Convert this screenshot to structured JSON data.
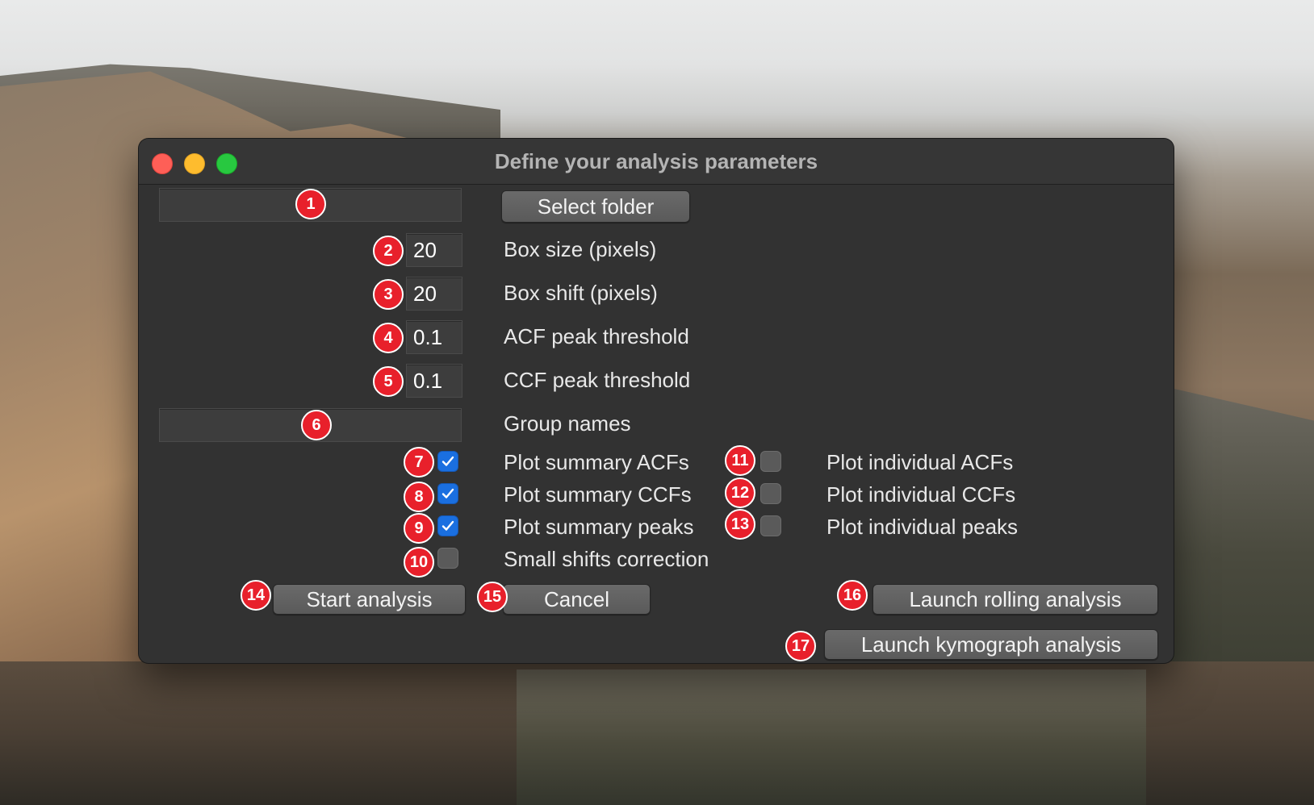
{
  "window": {
    "title": "Define your analysis parameters"
  },
  "form": {
    "folder_path": "",
    "select_folder_label": "Select folder",
    "box_size": {
      "value": "20",
      "label": "Box size (pixels)"
    },
    "box_shift": {
      "value": "20",
      "label": "Box shift (pixels)"
    },
    "acf_threshold": {
      "value": "0.1",
      "label": "ACF peak threshold"
    },
    "ccf_threshold": {
      "value": "0.1",
      "label": "CCF peak threshold"
    },
    "group_names": {
      "value": "",
      "label": "Group names"
    },
    "checkboxes_left": [
      {
        "label": "Plot summary ACFs",
        "checked": true
      },
      {
        "label": "Plot summary CCFs",
        "checked": true
      },
      {
        "label": "Plot summary peaks",
        "checked": true
      },
      {
        "label": "Small shifts correction",
        "checked": false
      }
    ],
    "checkboxes_right": [
      {
        "label": "Plot individual ACFs",
        "checked": false
      },
      {
        "label": "Plot individual CCFs",
        "checked": false
      },
      {
        "label": "Plot individual peaks",
        "checked": false
      }
    ]
  },
  "buttons": {
    "start": "Start analysis",
    "cancel": "Cancel",
    "rolling": "Launch rolling analysis",
    "kymograph": "Launch kymograph analysis"
  },
  "badges": [
    "1",
    "2",
    "3",
    "4",
    "5",
    "6",
    "7",
    "8",
    "9",
    "10",
    "11",
    "12",
    "13",
    "14",
    "15",
    "16",
    "17"
  ],
  "colors": {
    "badge": "#e8202b",
    "checkbox_on": "#1a6fe0",
    "window_bg": "#323232"
  }
}
